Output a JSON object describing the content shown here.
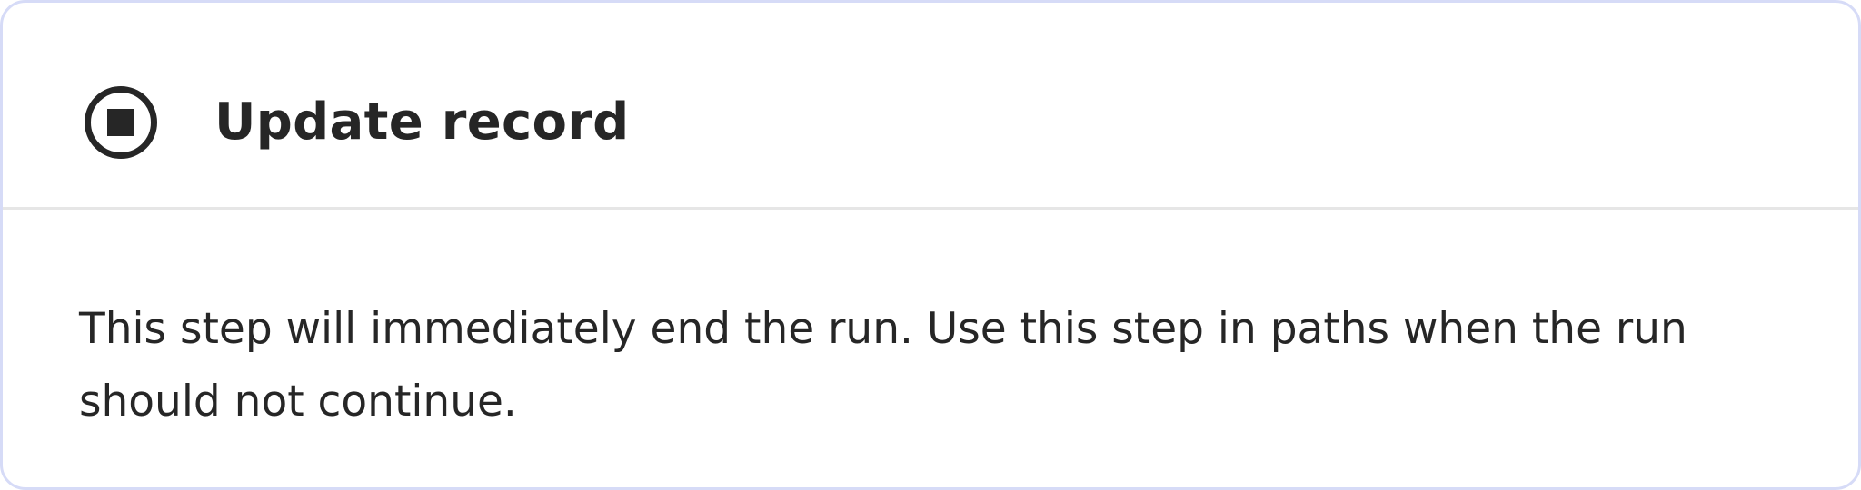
{
  "card": {
    "icon": "stop-circle-icon",
    "title": "Update record",
    "description": "This step will immediately end the run. Use this step in paths when the run should not continue."
  },
  "colors": {
    "border": "#d6dbf7",
    "divider": "#e6e6e6",
    "text": "#262626"
  }
}
